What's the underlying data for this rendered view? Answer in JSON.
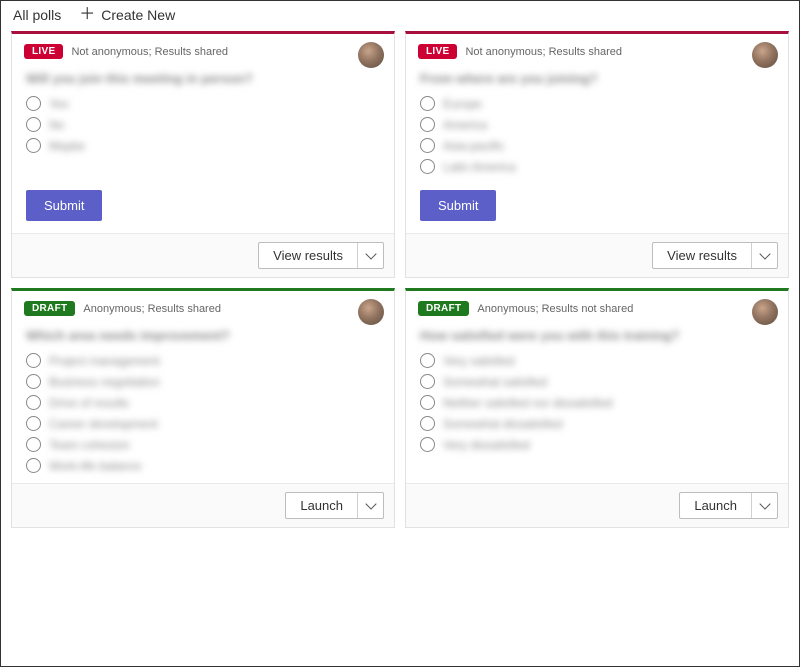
{
  "header": {
    "title": "All polls",
    "create_label": "Create New"
  },
  "actions": {
    "submit": "Submit",
    "view_results": "View results",
    "launch": "Launch"
  },
  "polls": [
    {
      "status": "LIVE",
      "status_type": "live",
      "meta": "Not anonymous; Results shared",
      "question": "Will you join this meeting in person?",
      "options": [
        "Yes",
        "No",
        "Maybe"
      ],
      "has_submit": true,
      "footer_action": "view_results"
    },
    {
      "status": "LIVE",
      "status_type": "live",
      "meta": "Not anonymous; Results shared",
      "question": "From where are you joining?",
      "options": [
        "Europe",
        "America",
        "Asia-pacific",
        "Latin America"
      ],
      "has_submit": true,
      "footer_action": "view_results"
    },
    {
      "status": "DRAFT",
      "status_type": "draft",
      "meta": "Anonymous; Results shared",
      "question": "Which area needs improvement?",
      "options": [
        "Project management",
        "Business negotiation",
        "Drive of results",
        "Career development",
        "Team cohesion",
        "Work-life balance"
      ],
      "has_submit": false,
      "footer_action": "launch"
    },
    {
      "status": "DRAFT",
      "status_type": "draft",
      "meta": "Anonymous; Results not shared",
      "question": "How satisfied were you with this training?",
      "options": [
        "Very satisfied",
        "Somewhat satisfied",
        "Neither satisfied nor dissatisfied",
        "Somewhat dissatisfied",
        "Very dissatisfied"
      ],
      "has_submit": false,
      "footer_action": "launch"
    }
  ]
}
